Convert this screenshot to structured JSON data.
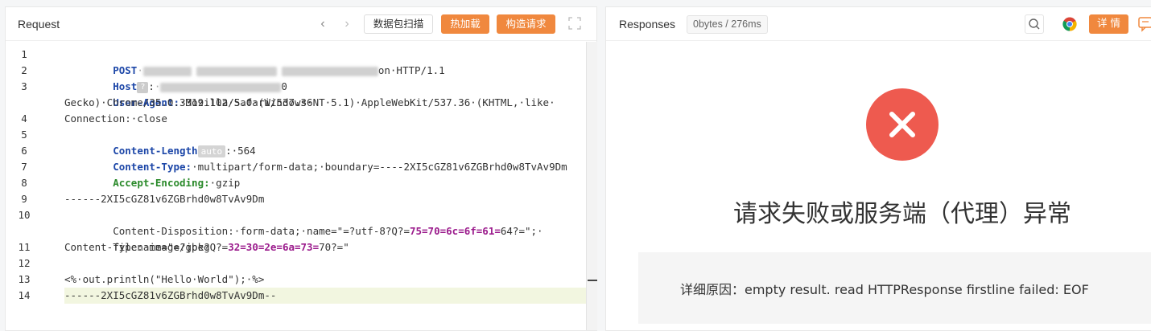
{
  "request": {
    "title": "Request",
    "buttons": {
      "scan": "数据包扫描",
      "hot_load": "热加载",
      "build_request": "构造请求"
    },
    "lines": [
      {
        "n": "1"
      },
      {
        "n": "2"
      },
      {
        "n": "3"
      },
      {
        "n": ""
      },
      {
        "n": "4"
      },
      {
        "n": "5"
      },
      {
        "n": "6"
      },
      {
        "n": "7"
      },
      {
        "n": "8"
      },
      {
        "n": "9"
      },
      {
        "n": "10"
      },
      {
        "n": ""
      },
      {
        "n": "11"
      },
      {
        "n": "12"
      },
      {
        "n": "13"
      },
      {
        "n": "14"
      }
    ],
    "code": {
      "l1_method": "POST",
      "l1_tail": "on·HTTP/1.1",
      "l2_key": "Host",
      "l2_badge": "?",
      "l2_tail": ":",
      "l2_port": "0",
      "l3_key": "User-Agent:",
      "l3_val": "·Mozilla/5.0·(Windows·NT·5.1)·AppleWebKit/537.36·(KHTML,·like·",
      "l3_cont": "Gecko)·Chrome/35.0.3319.102·Safari/537.36",
      "l4": "Connection:·close",
      "l5_key": "Content-Length",
      "l5_badge": "auto",
      "l5_val": ":·564",
      "l6_key": "Content-Type:",
      "l6_val": "·multipart/form-data;·boundary=----2XI5cGZ81v6ZGBrhd0w8TvAv9Dm",
      "l7_key": "Accept-Encoding:",
      "l7_val": "·gzip",
      "l9": "------2XI5cGZ81v6ZGBrhd0w8TvAv9Dm",
      "l10_a": "Content-Disposition:·form-data;·name=\"=?utf-8?Q?=",
      "l10_b": "75=70=6c=6f=61=",
      "l10_c": "64?=\";·",
      "l10b_a": "filename=\"=?gbk?Q?=",
      "l10b_b": "32=30=2e=6a=73=",
      "l10b_c": "70?=\"",
      "l11": "Content-Type:·image/jpeg",
      "l13": "<%·out.println(\"Hello·World\");·%>",
      "l14": "------2XI5cGZ81v6ZGBrhd0w8TvAv9Dm--"
    }
  },
  "response": {
    "title": "Responses",
    "stats": "0bytes / 276ms",
    "detail_button": "详 情",
    "error_title": "请求失败或服务端（代理）异常",
    "reason": "详细原因：empty result. read HTTPResponse firstline failed: EOF"
  },
  "colors": {
    "accent": "#f0883e",
    "error": "#ee5a4f",
    "header_key": "#1d47a8",
    "encoding_key": "#2a8a2a",
    "encoded_chars": "#9b1b8c"
  },
  "icons": [
    "chevron-left-icon",
    "chevron-right-icon",
    "expand-icon",
    "search-icon",
    "chrome-icon",
    "close-icon",
    "chat-icon"
  ]
}
